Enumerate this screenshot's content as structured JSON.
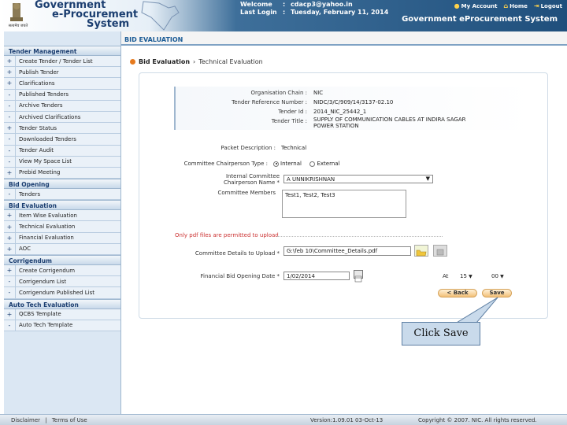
{
  "header": {
    "logo_line1": "Government",
    "logo_line2": "e-Procurement",
    "logo_line3": "System",
    "emblem_caption": "सत्यमेव जयते",
    "welcome_label": "Welcome",
    "welcome_value": "cdacp3@yahoo.in",
    "lastlogin_label": "Last Login",
    "lastlogin_value": "Tuesday, February 11, 2014",
    "separator": ":",
    "my_account": "My Account",
    "home": "Home",
    "logout": "Logout",
    "system_title": "Government eProcurement System"
  },
  "sidebar": {
    "sections": [
      {
        "title": "Tender Management",
        "items": [
          {
            "label": "Create Tender / Tender List",
            "icon": "+"
          },
          {
            "label": "Publish Tender",
            "icon": "+"
          },
          {
            "label": "Clarifications",
            "icon": "+"
          },
          {
            "label": "Published Tenders",
            "icon": "-"
          },
          {
            "label": "Archive Tenders",
            "icon": "-"
          },
          {
            "label": "Archived Clarifications",
            "icon": "-"
          },
          {
            "label": "Tender Status",
            "icon": "+"
          },
          {
            "label": "Downloaded Tenders",
            "icon": "-"
          },
          {
            "label": "Tender Audit",
            "icon": "-"
          },
          {
            "label": "View My Space List",
            "icon": "-"
          },
          {
            "label": "Prebid Meeting",
            "icon": "+"
          }
        ]
      },
      {
        "title": "Bid Opening",
        "items": [
          {
            "label": "Tenders",
            "icon": "-"
          }
        ]
      },
      {
        "title": "Bid Evaluation",
        "items": [
          {
            "label": "Item Wise Evaluation",
            "icon": "+"
          },
          {
            "label": "Technical Evaluation",
            "icon": "+"
          },
          {
            "label": "Financial Evaluation",
            "icon": "+"
          },
          {
            "label": "AOC",
            "icon": "+"
          }
        ]
      },
      {
        "title": "Corrigendum",
        "items": [
          {
            "label": "Create Corrigendum",
            "icon": "+"
          },
          {
            "label": "Corrigendum List",
            "icon": "-"
          },
          {
            "label": "Corrigendum Published List",
            "icon": "-"
          }
        ]
      },
      {
        "title": "Auto Tech Evaluation",
        "items": [
          {
            "label": "QCBS Template",
            "icon": "+"
          },
          {
            "label": "Auto Tech Template",
            "icon": "-"
          }
        ]
      }
    ]
  },
  "main": {
    "page_heading": "BID EVALUATION",
    "breadcrumb_root": "Bid Evaluation",
    "breadcrumb_sep": "›",
    "breadcrumb_current": "Technical Evaluation",
    "info": {
      "org_label": "Organisation Chain :",
      "org_value": "NIC",
      "ref_label": "Tender Reference Number :",
      "ref_value": "NIDC/3/C/909/14/3137-02.10",
      "id_label": "Tender Id :",
      "id_value": "2014_NIC_25442_1",
      "title_label": "Tender Title :",
      "title_value_1": "SUPPLY OF COMMUNICATION CABLES AT INDIRA SAGAR",
      "title_value_2": "POWER STATION"
    },
    "form": {
      "packet_label": "Packet Description :",
      "packet_value": "Technical",
      "chair_type_label": "Committee Chairperson Type :",
      "chair_type_options": [
        "Internal",
        "External"
      ],
      "chair_name_label_1": "Internal Committee",
      "chair_name_label_2": "Chairperson Name *",
      "chair_name_value": "A UNNIKRISHNAN",
      "members_label": "Committee Members",
      "members_value": "Test1, Test2, Test3",
      "pdf_note": "Only pdf files are permitted to upload",
      "upload_label": "Committee Details to Upload *",
      "upload_value": "G:\\feb 10\\Committee_Details.pdf",
      "date_label": "Financial Bid Opening Date *",
      "date_value": "1/02/2014",
      "at_label": "At",
      "hour_value": "15",
      "minute_value": "00",
      "back_label": "< Back",
      "save_label": "Save"
    },
    "callout": "Click Save"
  },
  "footer": {
    "disclaimer": "Disclaimer",
    "sep": "|",
    "terms": "Terms of Use",
    "version": "Version:1.09.01 03-Oct-13",
    "copyright": "Copyright © 2007. NIC. All rights reserved."
  },
  "colors": {
    "brand_dark": "#1b3e70",
    "accent_orange": "#e67a1e",
    "header_blue": "#1f4f7c"
  }
}
